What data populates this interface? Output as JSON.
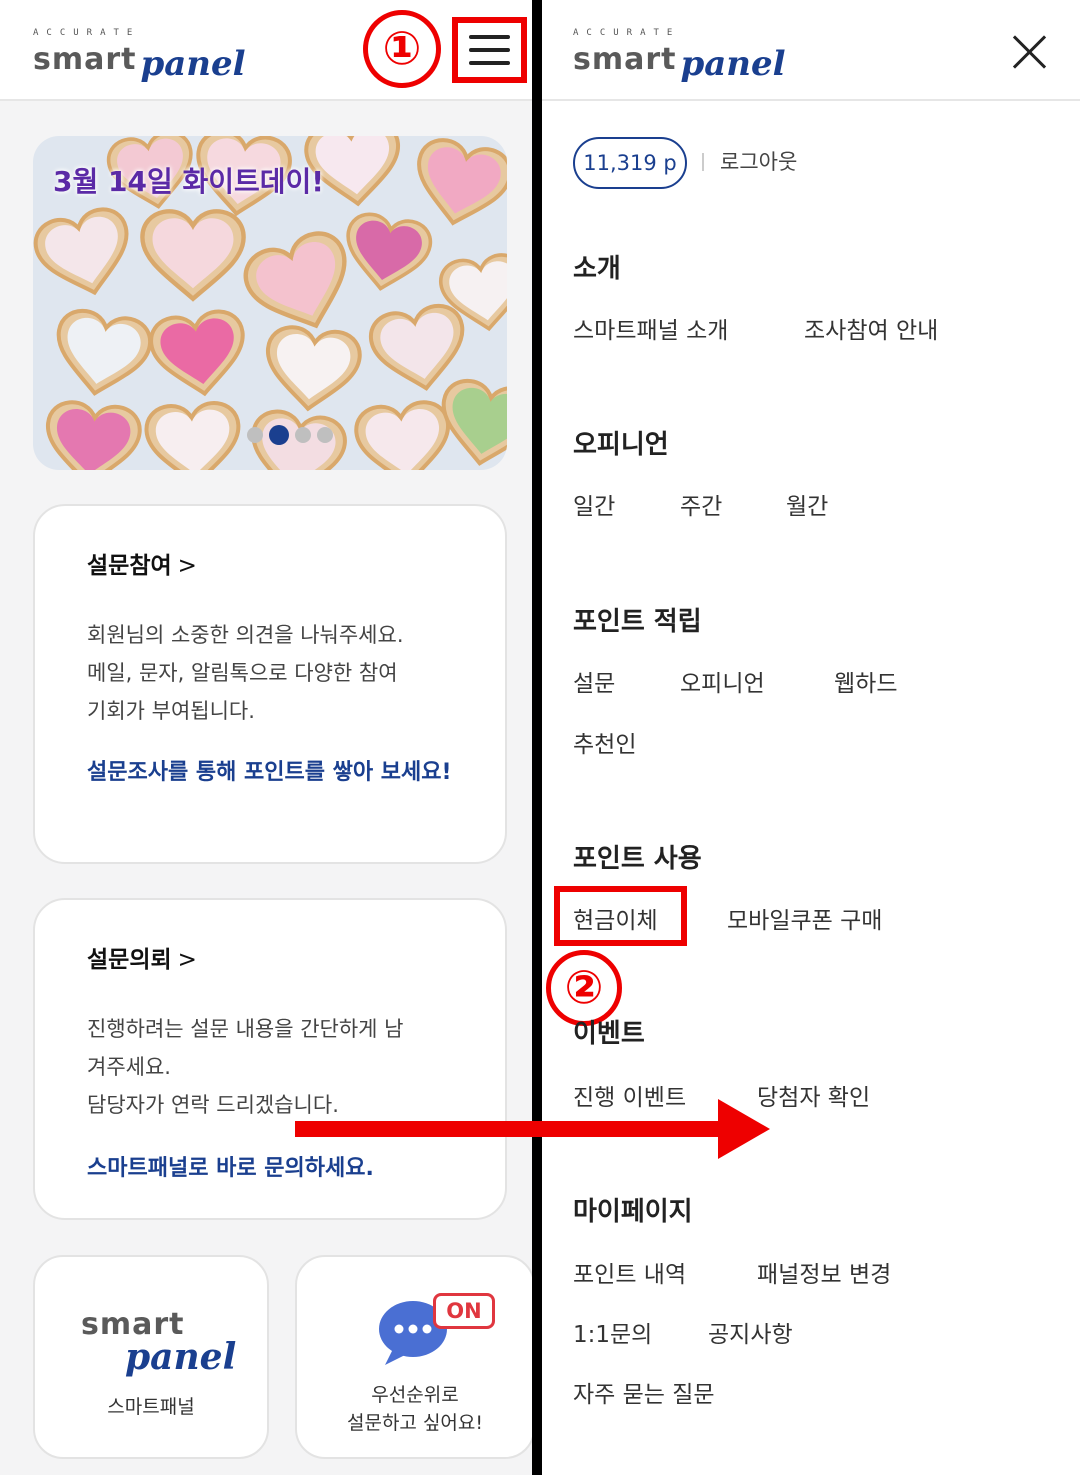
{
  "left": {
    "logo": {
      "top": "ACCURATE",
      "smart": "smart",
      "panel": "panel"
    },
    "annotation_1": "①",
    "banner": {
      "title": "3월 14일 화이트데이!",
      "slide_count": 4,
      "active_slide": 2
    },
    "survey_card": {
      "title": "설문참여",
      "chevron": ">",
      "body": [
        "회원님의 소중한 의견을 나눠주세요.",
        "메일, 문자, 알림톡으로 다양한 참여",
        "기회가 부여됩니다."
      ],
      "link": "설문조사를 통해 포인트를 쌓아 보세요!"
    },
    "request_card": {
      "title": "설문의뢰",
      "chevron": ">",
      "body": [
        "진행하려는 설문 내용을 간단하게 남",
        "겨주세요.",
        "담당자가 연락 드리겠습니다."
      ],
      "link": "스마트패널로 바로 문의하세요."
    },
    "tile_smartpanel": {
      "smart": "smart",
      "panel": "panel",
      "label": "스마트패널"
    },
    "tile_priority": {
      "badge": "ON",
      "label_line1": "우선순위로",
      "label_line2": "설문하고 싶어요!"
    }
  },
  "right": {
    "logo": {
      "top": "ACCURATE",
      "smart": "smart",
      "panel": "panel"
    },
    "points": "11,319 p",
    "logout": "로그아웃",
    "annotation_2": "②",
    "sections": {
      "intro": {
        "title": "소개",
        "items": [
          "스마트패널 소개",
          "조사참여 안내"
        ]
      },
      "opinion": {
        "title": "오피니언",
        "items": [
          "일간",
          "주간",
          "월간"
        ]
      },
      "earn": {
        "title": "포인트 적립",
        "items": [
          "설문",
          "오피니언",
          "웹하드",
          "추천인"
        ]
      },
      "use": {
        "title": "포인트 사용",
        "items": [
          "현금이체",
          "모바일쿠폰 구매"
        ]
      },
      "event": {
        "title": "이벤트",
        "items": [
          "진행 이벤트",
          "당첨자 확인"
        ]
      },
      "mypage": {
        "title": "마이페이지",
        "items": [
          "포인트 내역",
          "패널정보 변경",
          "1:1문의",
          "공지사항",
          "자주 묻는 질문"
        ]
      }
    }
  },
  "colors": {
    "brand_navy": "#1a3f8f",
    "annotation_red": "#e00000",
    "banner_purple": "#5b2aa6"
  },
  "icons": [
    "hamburger-menu-icon",
    "close-icon",
    "chat-bubble-icon",
    "chevron-right-icon"
  ]
}
